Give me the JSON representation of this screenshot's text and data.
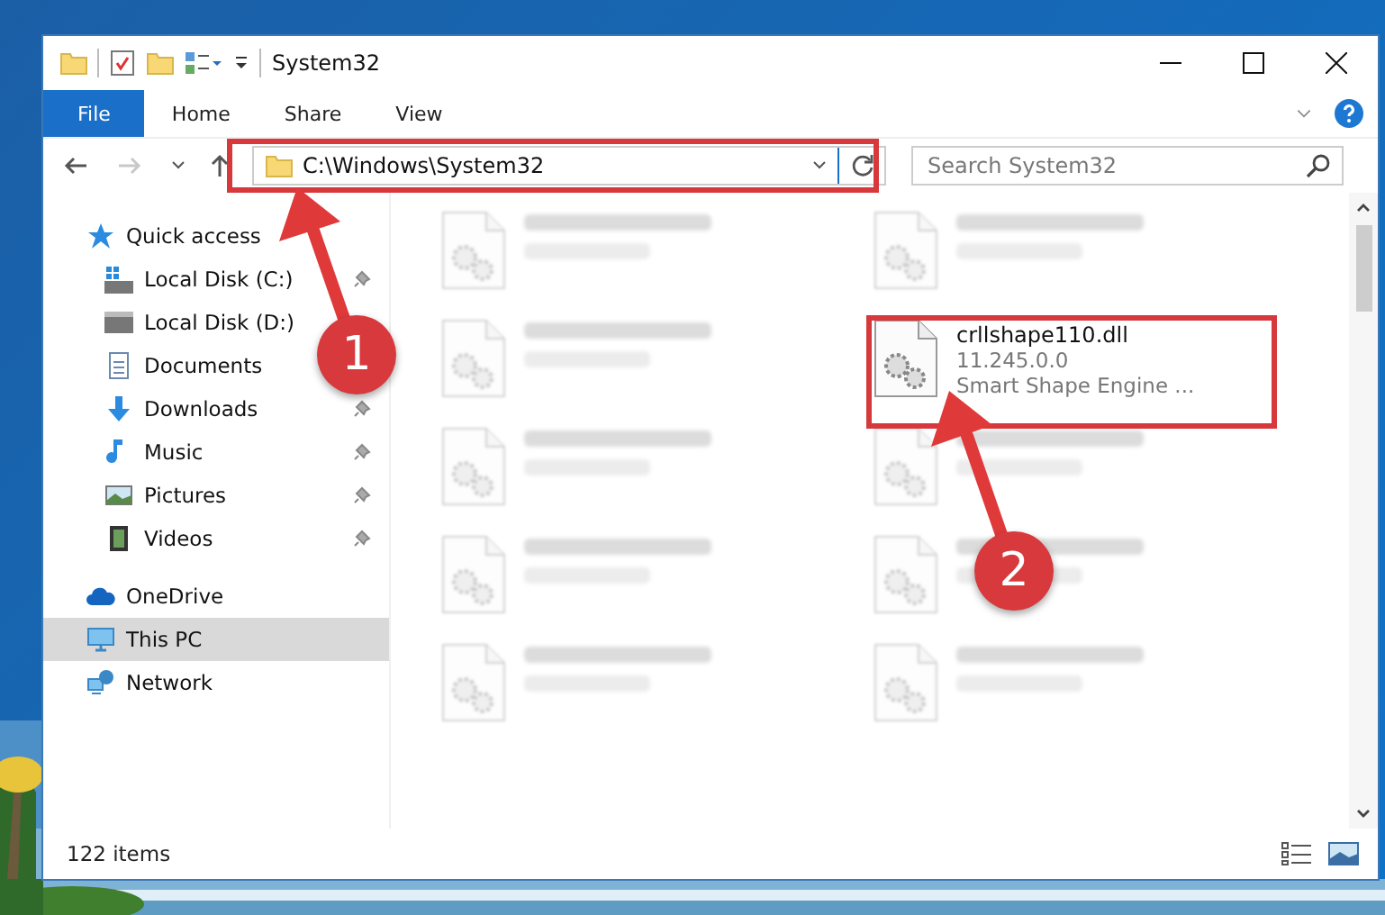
{
  "window": {
    "title": "System32"
  },
  "ribbon_tabs": [
    {
      "label": "File",
      "selected": true
    },
    {
      "label": "Home",
      "selected": false
    },
    {
      "label": "Share",
      "selected": false
    },
    {
      "label": "View",
      "selected": false
    }
  ],
  "address_bar": {
    "path": "C:\\Windows\\System32",
    "forward_disabled": true
  },
  "search": {
    "placeholder": "Search System32"
  },
  "sidebar": {
    "items": [
      {
        "label": "Quick access",
        "kind": "star",
        "selected": false,
        "children": [
          {
            "label": "Local Disk (C:)",
            "kind": "drive-windows",
            "pinned": true
          },
          {
            "label": "Local Disk (D:)",
            "kind": "drive",
            "pinned": false
          },
          {
            "label": "Documents",
            "kind": "documents",
            "pinned": false
          },
          {
            "label": "Downloads",
            "kind": "downloads",
            "pinned": true
          },
          {
            "label": "Music",
            "kind": "music",
            "pinned": true
          },
          {
            "label": "Pictures",
            "kind": "pictures",
            "pinned": true
          },
          {
            "label": "Videos",
            "kind": "videos",
            "pinned": true
          }
        ]
      },
      {
        "label": "OneDrive",
        "kind": "cloud",
        "selected": false
      },
      {
        "label": "This PC",
        "kind": "computer",
        "selected": true
      },
      {
        "label": "Network",
        "kind": "network",
        "selected": false
      }
    ]
  },
  "files": [
    {
      "kind": "blurred"
    },
    {
      "kind": "blurred"
    },
    {
      "kind": "blurred"
    },
    {
      "kind": "file",
      "name": "crllshape110.dll",
      "lines": [
        "11.245.0.0",
        "Smart Shape Engine ..."
      ]
    },
    {
      "kind": "blurred"
    },
    {
      "kind": "blurred"
    },
    {
      "kind": "blurred"
    },
    {
      "kind": "blurred"
    },
    {
      "kind": "blurred"
    },
    {
      "kind": "blurred"
    }
  ],
  "status_bar": {
    "item_count": "122 items"
  },
  "annotations": [
    {
      "label": "1"
    },
    {
      "label": "2"
    }
  ]
}
